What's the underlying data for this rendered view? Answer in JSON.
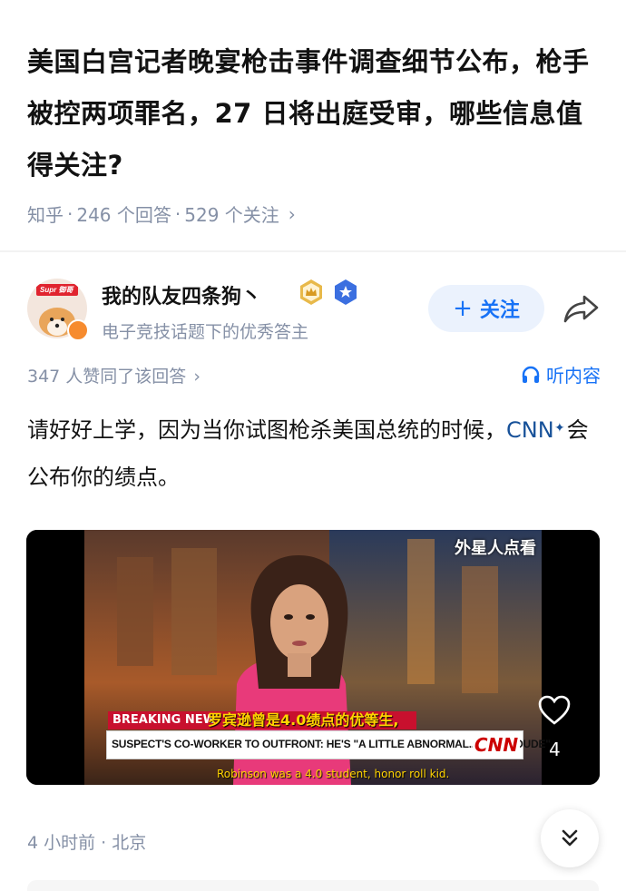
{
  "question": {
    "title": "美国白宫记者晚宴枪击事件调查细节公布，枪手被控两项罪名，27 日将出庭受审，哪些信息值得关注?",
    "source": "知乎",
    "answers": "246 个回答",
    "followers": "529 个关注"
  },
  "author": {
    "name": "我的队友四条狗丶",
    "avatar_tag": "Supr 御哥",
    "description": "电子竞技话题下的优秀答主",
    "follow_label": "关注"
  },
  "stats": {
    "likes_text": "347 人赞同了该回答",
    "listen_label": "听内容"
  },
  "answer": {
    "text_before": "请好好上学，因为当你试图枪杀美国总统的时候，",
    "link_text": "CNN",
    "text_after": "会公布你的绩点。"
  },
  "video": {
    "watermark": "外星人点看",
    "breaking": "BREAKING NEW",
    "subtitle_cn": "罗宾逊曾是4.0绩点的优等生,",
    "chyron": "SUSPECT'S CO-WORKER TO OUTFRONT: HE'S \"A LITTLE ABNORMAL... QUIET DUDE\"",
    "cnn_logo": "CNN",
    "subtitle_en": "Robinson was a 4.0 student, honor roll kid.",
    "like_count": "4"
  },
  "footer": {
    "meta": "4 小时前 · 北京"
  },
  "colors": {
    "accent": "#1772f6",
    "link": "#175199",
    "meta": "#8590a6"
  }
}
